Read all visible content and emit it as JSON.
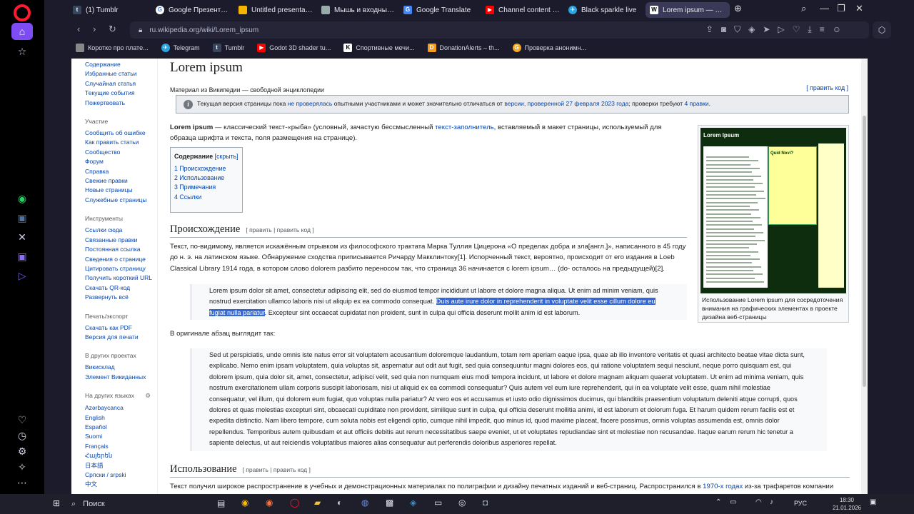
{
  "tabs": [
    {
      "label": "(1) Tumblr",
      "color": "#36465d",
      "glyph": "t"
    },
    {
      "label": "Google Презентации: со",
      "color": "#4285f4",
      "glyph": "G"
    },
    {
      "label": "Untitled presentation - Go",
      "color": "#f4b400",
      "glyph": "▭"
    },
    {
      "label": "Мышь и входные коорд",
      "color": "#555555",
      "glyph": "▦"
    },
    {
      "label": "Google Translate",
      "color": "#4285f4",
      "glyph": "G"
    },
    {
      "label": "Channel content - YouTub",
      "color": "#ff0000",
      "glyph": "▶"
    },
    {
      "label": "Black sparkle live",
      "color": "#2aa3e0",
      "glyph": "✈"
    },
    {
      "label": "Lorem ipsum — Википед",
      "color": "#ffffff",
      "glyph": "W"
    }
  ],
  "address": {
    "url": "ru.wikipedia.org/wiki/Lorem_ipsum"
  },
  "bookmarks": [
    {
      "label": "Коротко про плате...",
      "color": "#7a7a7a",
      "glyph": "◧"
    },
    {
      "label": "Telegram",
      "color": "#2aa3e0",
      "glyph": "✈"
    },
    {
      "label": "Tumblr",
      "color": "#36465d",
      "glyph": "t"
    },
    {
      "label": "Godot 3D shader tu...",
      "color": "#ff0000",
      "glyph": "▶"
    },
    {
      "label": "Спортивные мечи...",
      "color": "#ffffff",
      "glyph": "K"
    },
    {
      "label": "DonationAlerts – th...",
      "color": "#f59c1a",
      "glyph": "D"
    },
    {
      "label": "Проверка анонимн...",
      "color": "#f5a623",
      "glyph": "G"
    }
  ],
  "left_nav": {
    "top_items": [
      "Содержание",
      "Избранные статьи",
      "Случайная статья",
      "Текущие события",
      "Пожертвовать"
    ],
    "participation_head": "Участие",
    "participation": [
      "Сообщить об ошибке",
      "Как править статьи",
      "Сообщество",
      "Форум",
      "Справка",
      "Свежие правки",
      "Новые страницы",
      "Служебные страницы"
    ],
    "tools_head": "Инструменты",
    "tools": [
      "Ссылки сюда",
      "Связанные правки",
      "Постоянная ссылка",
      "Сведения о странице",
      "Цитировать страницу",
      "Получить короткий URL",
      "Скачать QR-код",
      "Развернуть всё"
    ],
    "print_head": "Печать/экспорт",
    "print": [
      "Скачать как PDF",
      "Версия для печати"
    ],
    "projects_head": "В других проектах",
    "projects": [
      "Викисклад",
      "Элемент Викиданных"
    ],
    "langs_head": "На других языках",
    "langs": [
      "Azərbaycanca",
      "English",
      "Español",
      "Suomi",
      "Français",
      "Հայերեն",
      "日本語",
      "Српски / srpski",
      "中文"
    ]
  },
  "article": {
    "title": "Lorem ipsum",
    "tagline": "Материал из Википедии — свободной энциклопедии",
    "edit_code": "[ править код ]",
    "notice_a": "Текущая версия страницы пока ",
    "notice_link1": "не проверялась",
    "notice_b": " опытными участниками и может значительно отличаться от ",
    "notice_link2": "версии, проверенной 27 февраля 2023 года",
    "notice_c": "; проверки требуют ",
    "notice_link3": "4 правки",
    "notice_d": ".",
    "intro_bold": "Lorem ipsum",
    "intro_a": " — классический текст-«рыба» (условный, зачастую бессмысленный ",
    "intro_link": "текст-заполнитель",
    "intro_b": ", вставляемый в макет страницы, используемый для образца шрифта и текста, поля размещения на странице).",
    "toc_title": "Содержание",
    "toc_hide": "[скрыть]",
    "toc": [
      "1  Происхождение",
      "2  Использование",
      "3  Примечания",
      "4  Ссылки"
    ],
    "section1": "Происхождение",
    "section_edit": "[ править | править код ]",
    "origin_para": "Текст, по-видимому, является искажённым отрывком из философского трактата Марка Туллия Цицерона «О пределах добра и зла[англ.]», написанного в 45 году до н. э. на латинском языке. Обнаружение сходства приписывается Ричарду Макклинтоку[1]. Испорченный текст, вероятно, происходит от его издания в Loeb Classical Library 1914 года, в котором слово dolorem разбито переносом так, что страница 36 начинается с lorem ipsum… (do- осталось на предыдущей)[2].",
    "quote1_a": "Lorem ipsum dolor sit amet, consectetur adipiscing elit, sed do eiusmod tempor incididunt ut labore et dolore magna aliqua. Ut enim ad minim veniam, quis nostrud exercitation ullamco laboris nisi ut aliquip ex ea commodo consequat. ",
    "quote1_sel": "Duis aute irure dolor in reprehenderit in voluptate velit esse cillum dolore eu fugiat nulla pariatur",
    "quote1_b": ". Excepteur sint occaecat cupidatat non proident, sunt in culpa qui officia deserunt mollit anim id est laborum.",
    "original_label": "В оригинале абзац выглядит так:",
    "quote2": "Sed ut perspiciatis, unde omnis iste natus error sit voluptatem accusantium doloremque laudantium, totam rem aperiam eaque ipsa, quae ab illo inventore veritatis et quasi architecto beatae vitae dicta sunt, explicabo. Nemo enim ipsam voluptatem, quia voluptas sit, aspernatur aut odit aut fugit, sed quia consequuntur magni dolores eos, qui ratione voluptatem sequi nesciunt, neque porro quisquam est, qui dolorem ipsum, quia dolor sit, amet, consectetur, adipisci velit, sed quia non numquam eius modi tempora incidunt, ut labore et dolore magnam aliquam quaerat voluptatem. Ut enim ad minima veniam, quis nostrum exercitationem ullam corporis suscipit laboriosam, nisi ut aliquid ex ea commodi consequatur? Quis autem vel eum iure reprehenderit, qui in ea voluptate velit esse, quam nihil molestiae consequatur, vel illum, qui dolorem eum fugiat, quo voluptas nulla pariatur? At vero eos et accusamus et iusto odio dignissimos ducimus, qui blanditiis praesentium voluptatum deleniti atque corrupti, quos dolores et quas molestias excepturi sint, obcaecati cupiditate non provident, similique sunt in culpa, qui officia deserunt mollitia animi, id est laborum et dolorum fuga. Et harum quidem rerum facilis est et expedita distinctio. Nam libero tempore, cum soluta nobis est eligendi optio, cumque nihil impedit, quo minus id, quod maxime placeat, facere possimus, omnis voluptas assumenda est, omnis dolor repellendus. Temporibus autem quibusdam et aut officiis debitis aut rerum necessitatibus saepe eveniet, ut et voluptates repudiandae sint et molestiae non recusandae. Itaque earum rerum hic tenetur a sapiente delectus, ut aut reiciendis voluptatibus maiores alias consequatur aut perferendis doloribus asperiores repellat.",
    "section2": "Использование",
    "usage_para_a": "Текст получил широкое распространение в учебных и демонстрационных материалах по полиграфии и дизайну печатных изданий и веб-страниц. Распространился в ",
    "usage_link": "1970-х годах",
    "usage_para_b": " из-за трафаретов компании",
    "image_title": "Lorem Ipsum",
    "image_panel": "Quid Novi?",
    "image_caption": "Использование Lorem ipsum для сосредоточения внимания на графических элементах в проекте дизайна веб-страницы"
  },
  "taskbar": {
    "search_label": "Поиск",
    "lang": "РУС",
    "time": "18:30",
    "date": "21.01.2026"
  }
}
